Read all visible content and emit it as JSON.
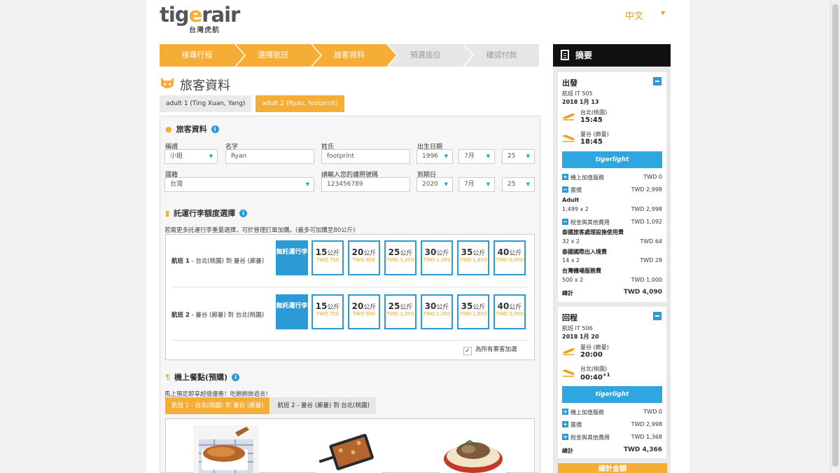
{
  "header": {
    "logo_main_a": "tig",
    "logo_main_b": "e",
    "logo_main_c": "rair",
    "logo_sub": "台灣虎航",
    "language": "中文"
  },
  "steps": [
    {
      "label": "搜尋行程",
      "active": true
    },
    {
      "label": "選擇航班",
      "active": true
    },
    {
      "label": "旅客資料",
      "active": true
    },
    {
      "label": "預選座位",
      "active": false
    },
    {
      "label": "確認付款",
      "active": false
    }
  ],
  "page": {
    "title": "旅客資料",
    "pax_tabs": [
      {
        "label": "adult 1 (Ting Xuan, Yang)",
        "active": false
      },
      {
        "label": "adult 2 (Ryan, footprint)",
        "active": true
      }
    ]
  },
  "passenger": {
    "section_title": "旅客資料",
    "title_label": "稱謂",
    "title_value": "小姐",
    "first_name_label": "名字",
    "first_name_value": "Ryan",
    "last_name_label": "姓氏",
    "last_name_value": "footprint",
    "dob_label": "出生日期",
    "dob_year": "1996",
    "dob_month": "7月",
    "dob_day": "25",
    "nationality_label": "國籍",
    "nationality_value": "台灣",
    "passport_label": "請輸入您的護照號碼",
    "passport_value": "123456789",
    "expiry_label": "到期日",
    "expiry_year": "2020",
    "expiry_month": "7月",
    "expiry_day": "25"
  },
  "baggage": {
    "section_title": "託運行李額度選擇",
    "note": "若需更多託運行李重量選擇，可於管理訂單加購。(最多可加購至80公斤)",
    "none_label": "無託運行李",
    "unit": "公斤",
    "options": [
      {
        "kg": "15",
        "price": "TWD 750"
      },
      {
        "kg": "20",
        "price": "TWD 850"
      },
      {
        "kg": "25",
        "price": "TWD 1,050"
      },
      {
        "kg": "30",
        "price": "TWD 1,350"
      },
      {
        "kg": "35",
        "price": "TWD 1,650"
      },
      {
        "kg": "40",
        "price": "TWD 2,000"
      }
    ],
    "flight1_prefix": "航班 1",
    "flight1_route": " - 台北(桃園) 到 曼谷 (廊曼)",
    "flight2_prefix": "航班 2",
    "flight2_route": " - 曼谷 (廊曼) 到 台北(桃園)",
    "apply_all": "為所有乘客加選"
  },
  "meals": {
    "section_title": "機上餐點(預購)",
    "note": "馬上預定即享超值優惠！吃飽飽旅遊去!",
    "tab1": "航班 1 - 台北(桃園) 到 曼谷 (廊曼)",
    "tab2": "航班 2 - 曼谷 (廊曼) 到 台北(桃園)"
  },
  "summary": {
    "title": "摘要",
    "depart": {
      "heading": "出發",
      "flight": "航班 IT 505",
      "date": "2018 1月 13",
      "from_city": "台北(桃園)",
      "from_time": "15:45",
      "to_city": "曼谷 (廊曼)",
      "to_time": "18:45",
      "fare_brand": "tigerlight",
      "addon_label": "機上加值服務",
      "addon_value": "TWD 0",
      "fare_label": "票價",
      "fare_value": "TWD 2,998",
      "adult_label": "Adult",
      "adult_calc": "1,499 x 2",
      "adult_value": "TWD 2,998",
      "tax_label": "稅金與其他費用",
      "tax_value": "TWD 1,092",
      "fee1_label": "泰國旅客處理設施使用費",
      "fee1_calc": "32 x 2",
      "fee1_value": "TWD 64",
      "fee2_label": "泰國國際出入境費",
      "fee2_calc": "14 x 2",
      "fee2_value": "TWD 28",
      "fee3_label": "台灣機場服務費",
      "fee3_calc": "500 x 2",
      "fee3_value": "TWD 1,000",
      "total_label": "總計",
      "total_value": "TWD 4,090"
    },
    "return": {
      "heading": "回程",
      "flight": "航班 IT 506",
      "date": "2018 1月 20",
      "from_city": "曼谷 (廊曼)",
      "from_time": "20:00",
      "to_city": "台北(桃園)",
      "to_time": "00:40",
      "to_time_sup": "+1",
      "fare_brand": "tigerlight",
      "addon_label": "機上加值服務",
      "addon_value": "TWD 0",
      "fare_label": "票價",
      "fare_value": "TWD 2,998",
      "tax_label": "稅金與其他費用",
      "tax_value": "TWD 1,368",
      "total_label": "總計",
      "total_value": "TWD 4,366"
    },
    "grand_total_label": "總計金額"
  },
  "colors": {
    "accent": "#f6ad36",
    "blue": "#2b9ad6",
    "tiger_bar": "#2ea6e0"
  }
}
